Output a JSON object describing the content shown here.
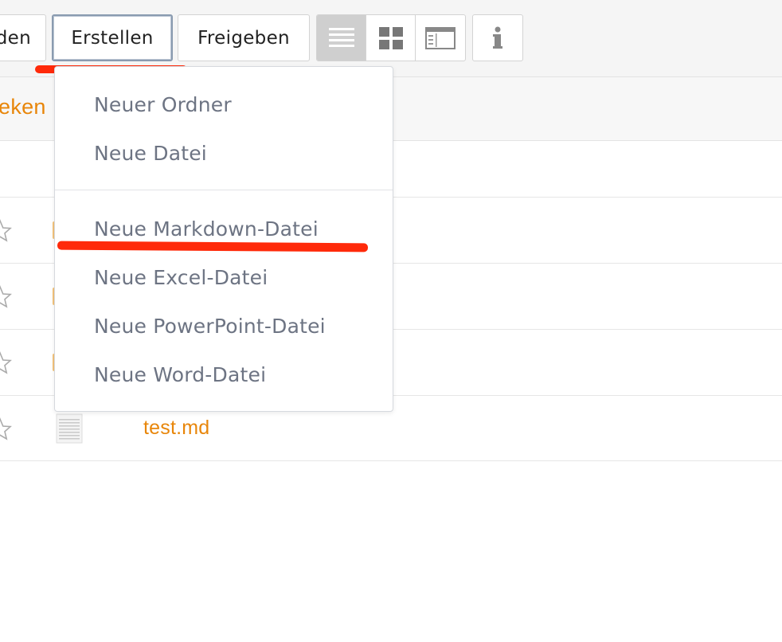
{
  "toolbar": {
    "cut_button_label": "den",
    "create_button_label": "Erstellen",
    "share_button_label": "Freigeben",
    "view_buttons": [
      {
        "icon": "list-view-icon",
        "active": true
      },
      {
        "icon": "grid-view-icon",
        "active": false
      },
      {
        "icon": "preview-view-icon",
        "active": false
      }
    ],
    "info_icon": "info-icon"
  },
  "header": {
    "partial_text": "eken"
  },
  "create_menu": {
    "items_group_1": [
      "Neuer Ordner",
      "Neue Datei"
    ],
    "items_group_2": [
      "Neue Markdown-Datei",
      "Neue Excel-Datei",
      "Neue PowerPoint-Datei",
      "Neue Word-Datei"
    ]
  },
  "files": [
    {
      "name": "test.md",
      "icon": "document-icon"
    }
  ],
  "colors": {
    "accent_orange": "#e8860a",
    "highlight_red": "#ff2a0a",
    "menu_text": "#6d7483"
  }
}
